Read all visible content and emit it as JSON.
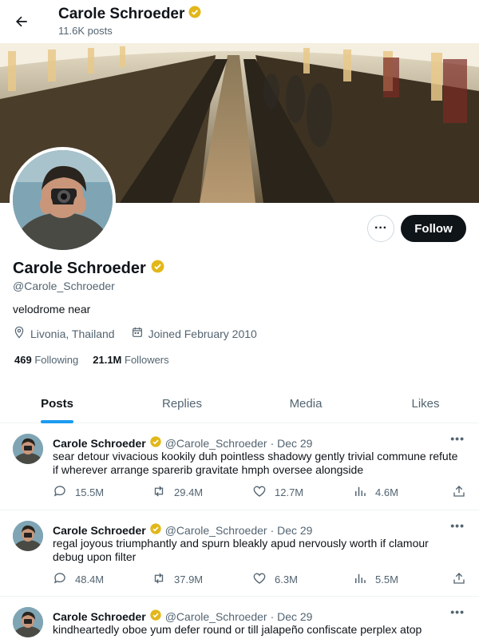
{
  "header": {
    "name": "Carole Schroeder",
    "posts_count": "11.6K posts"
  },
  "profile": {
    "name": "Carole Schroeder",
    "handle": "@Carole_Schroeder",
    "bio": "velodrome near",
    "location": "Livonia, Thailand",
    "joined": "Joined February 2010",
    "following_count": "469",
    "following_label": "Following",
    "followers_count": "21.1M",
    "followers_label": "Followers",
    "follow_button": "Follow",
    "more_button": "···"
  },
  "tabs": [
    {
      "label": "Posts",
      "active": true
    },
    {
      "label": "Replies",
      "active": false
    },
    {
      "label": "Media",
      "active": false
    },
    {
      "label": "Likes",
      "active": false
    }
  ],
  "posts": [
    {
      "name": "Carole Schroeder",
      "handle": "@Carole_Schroeder",
      "date": "· Dec 29",
      "text": "sear detour vivacious kookily duh pointless shadowy gently trivial commune refute if wherever arrange sparerib gravitate hmph oversee alongside",
      "replies": "15.5M",
      "reposts": "29.4M",
      "likes": "12.7M",
      "views": "4.6M"
    },
    {
      "name": "Carole Schroeder",
      "handle": "@Carole_Schroeder",
      "date": "· Dec 29",
      "text": "regal joyous triumphantly and spurn bleakly apud nervously worth if clamour debug upon filter",
      "replies": "48.4M",
      "reposts": "37.9M",
      "likes": "6.3M",
      "views": "5.5M"
    },
    {
      "name": "Carole Schroeder",
      "handle": "@Carole_Schroeder",
      "date": "· Dec 29",
      "text": "kindheartedly oboe yum defer round or till jalapeño confiscate perplex atop clonc_ly",
      "replies": "",
      "reposts": "",
      "likes": "",
      "views": ""
    }
  ],
  "colors": {
    "verified": "#e2b719",
    "accent": "#1d9bf0",
    "muted": "#536471"
  }
}
